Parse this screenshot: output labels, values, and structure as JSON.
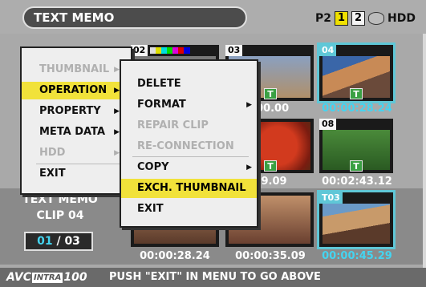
{
  "header": {
    "title": "TEXT MEMO",
    "p2_label": "P2",
    "slot1": "1",
    "slot2": "2",
    "hdd_label": "HDD"
  },
  "thumbnails": [
    {
      "num": "02"
    },
    {
      "num": "03",
      "timecode": ":00.00",
      "t_badge": "T"
    },
    {
      "num": "04",
      "timecode": "00:00:28.24",
      "t_badge": "T"
    },
    {
      "timecode": "49.09",
      "t_badge": "T"
    },
    {
      "num": "08",
      "timecode": "00:02:43.12",
      "t_badge": "T"
    },
    {
      "timecode": "00:00:28.24"
    },
    {
      "timecode": "00:00:35.09"
    },
    {
      "num": "T03",
      "timecode": "00:00:45.29"
    }
  ],
  "info": {
    "title": "TEXT MEMO",
    "clip": "CLIP 04",
    "page_current": "01",
    "page_sep": "/",
    "page_total": "03"
  },
  "main_menu": {
    "items": [
      {
        "label": "THUMBNAIL",
        "arrow": "▶"
      },
      {
        "label": "OPERATION",
        "arrow": "▶"
      },
      {
        "label": "PROPERTY",
        "arrow": "▶"
      },
      {
        "label": "META DATA",
        "arrow": "▶"
      },
      {
        "label": "HDD",
        "arrow": "▶"
      },
      {
        "label": "EXIT"
      }
    ]
  },
  "sub_menu": {
    "items": [
      {
        "label": "DELETE"
      },
      {
        "label": "FORMAT",
        "arrow": "▶"
      },
      {
        "label": "REPAIR CLIP"
      },
      {
        "label": "RE-CONNECTION"
      },
      {
        "label": "COPY",
        "arrow": "▶"
      },
      {
        "label": "EXCH. THUMBNAIL"
      },
      {
        "label": "EXIT"
      }
    ]
  },
  "footer": {
    "codec_pre": "AVC",
    "codec_intra": "INTRA",
    "codec_post": "100",
    "message": "PUSH \"EXIT\" IN MENU TO GO ABOVE"
  },
  "colors": {
    "highlight": "#f1e23a",
    "selected_border": "#5fc7d7",
    "timecode_selected": "#44d4f0"
  }
}
